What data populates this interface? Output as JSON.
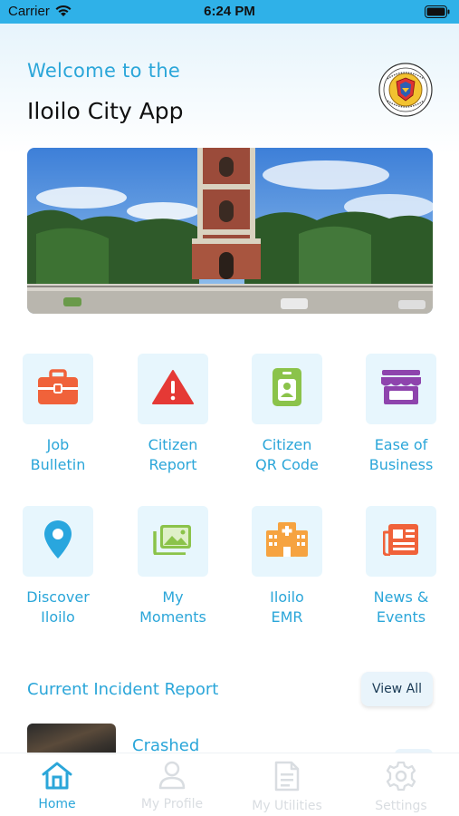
{
  "status_bar": {
    "carrier": "Carrier",
    "time": "6:24 PM"
  },
  "header": {
    "welcome": "Welcome to the",
    "title": "Iloilo City App",
    "seal_text_top": "CITY OF ILOILO",
    "seal_text_bottom": "PHILIPPINES"
  },
  "menu": [
    {
      "label": "Job\nBulletin",
      "icon": "briefcase-icon",
      "color": "#f0623a"
    },
    {
      "label": "Citizen\nReport",
      "icon": "warning-icon",
      "color": "#e53935"
    },
    {
      "label": "Citizen\nQR Code",
      "icon": "id-badge-icon",
      "color": "#8bc34a"
    },
    {
      "label": "Ease of\nBusiness",
      "icon": "storefront-icon",
      "color": "#8e44ad"
    },
    {
      "label": "Discover\nIloilo",
      "icon": "location-pin-icon",
      "color": "#29a6de"
    },
    {
      "label": "My\nMoments",
      "icon": "photo-album-icon",
      "color": "#8bc34a"
    },
    {
      "label": "Iloilo\nEMR",
      "icon": "hospital-icon",
      "color": "#f6a340"
    },
    {
      "label": "News &\nEvents",
      "icon": "newspaper-icon",
      "color": "#f0623a"
    }
  ],
  "incidents": {
    "title": "Current Incident Report",
    "view_all": "View All",
    "items": [
      {
        "title": "Crashed"
      }
    ]
  },
  "tabbar": {
    "tabs": [
      {
        "label": "Home",
        "icon": "home-icon",
        "active": true
      },
      {
        "label": "My Profile",
        "icon": "user-icon",
        "active": false
      },
      {
        "label": "My Utilities",
        "icon": "document-icon",
        "active": false
      },
      {
        "label": "Settings",
        "icon": "gear-icon",
        "active": false
      }
    ]
  },
  "colors": {
    "accent": "#2ba6d9",
    "status_bar": "#2fb1e8",
    "tile_bg": "#e7f6fd",
    "tab_inactive": "#d9dde1"
  }
}
